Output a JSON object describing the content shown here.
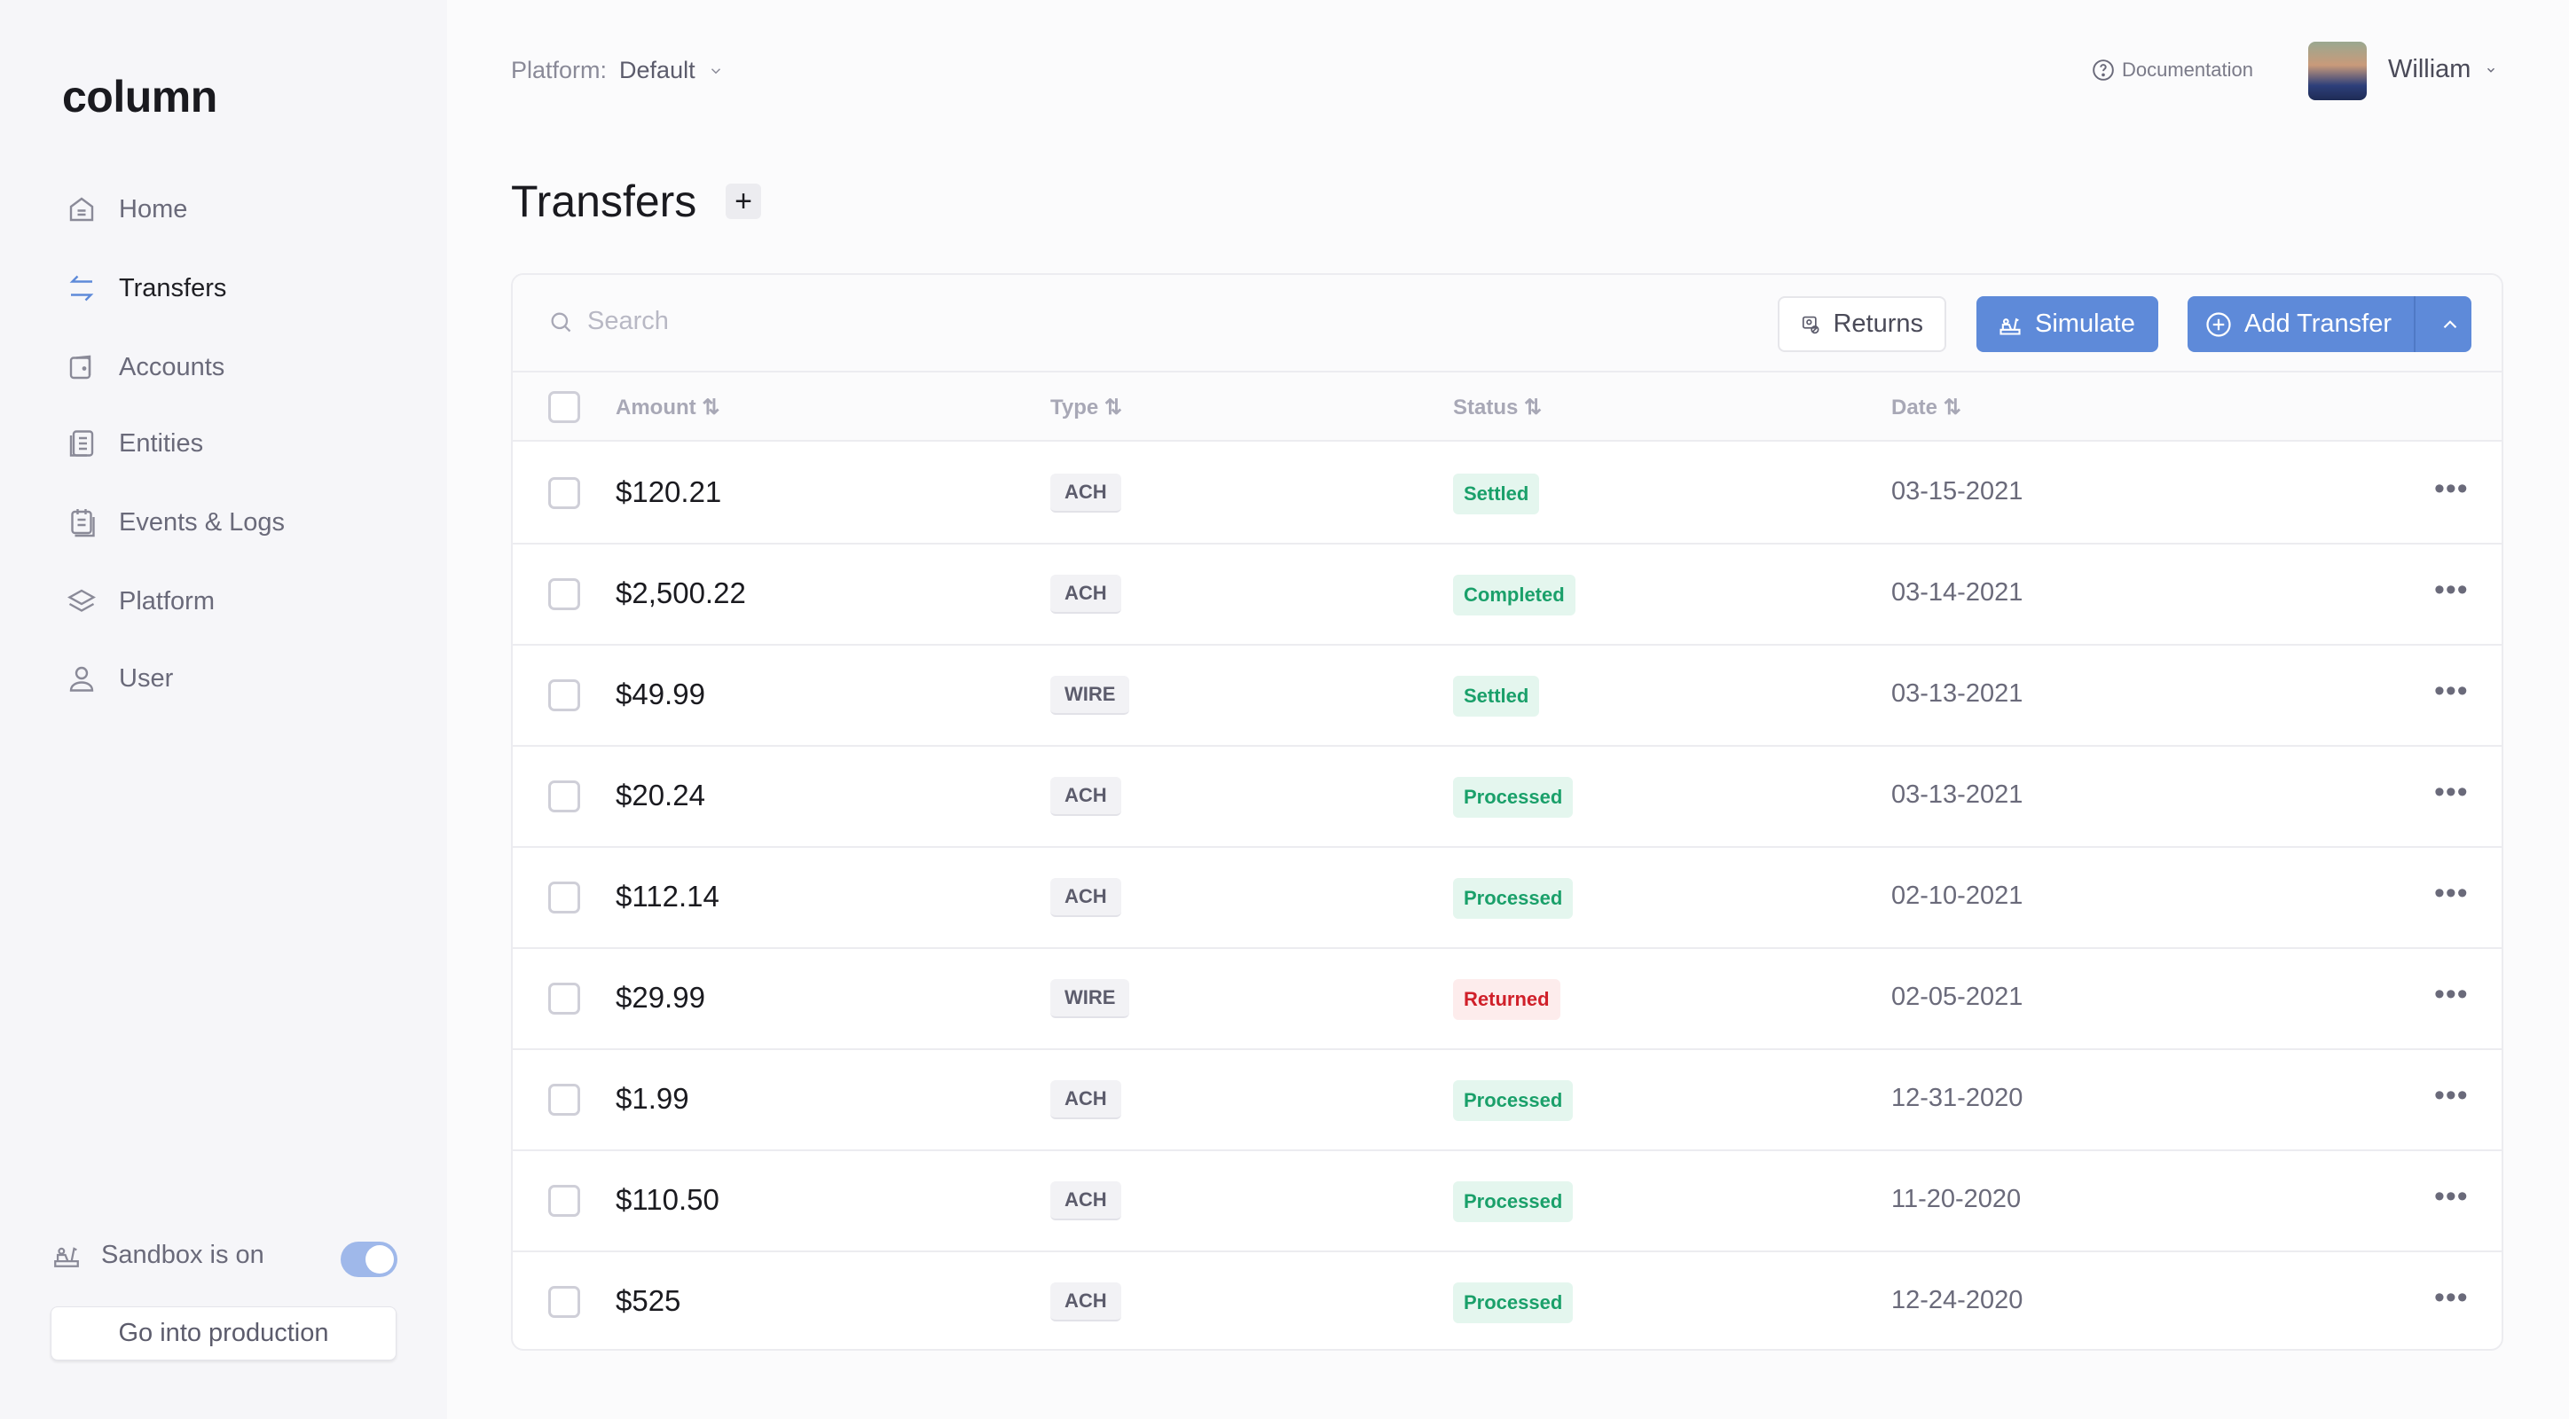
{
  "sidebar": {
    "logo": "column",
    "items": [
      {
        "label": "Home",
        "icon": "home-icon"
      },
      {
        "label": "Transfers",
        "icon": "transfers-icon",
        "active": true
      },
      {
        "label": "Accounts",
        "icon": "accounts-icon"
      },
      {
        "label": "Entities",
        "icon": "entities-icon"
      },
      {
        "label": "Events & Logs",
        "icon": "events-icon"
      },
      {
        "label": "Platform",
        "icon": "layers-icon"
      },
      {
        "label": "User",
        "icon": "user-icon"
      }
    ],
    "sandbox_label": "Sandbox is on",
    "sandbox_on": true,
    "production_button": "Go into production"
  },
  "header": {
    "platform_label": "Platform:",
    "platform_value": "Default",
    "documentation": "Documentation",
    "user_name": "William"
  },
  "page": {
    "title": "Transfers"
  },
  "toolbar": {
    "search_placeholder": "Search",
    "returns": "Returns",
    "simulate": "Simulate",
    "add_transfer": "Add Transfer"
  },
  "table": {
    "headers": [
      "Amount",
      "Type",
      "Status",
      "Date"
    ],
    "rows": [
      {
        "amount": "$120.21",
        "type": "ACH",
        "status": "Settled",
        "date": "03-15-2021"
      },
      {
        "amount": "$2,500.22",
        "type": "ACH",
        "status": "Completed",
        "date": "03-14-2021"
      },
      {
        "amount": "$49.99",
        "type": "WIRE",
        "status": "Settled",
        "date": "03-13-2021"
      },
      {
        "amount": "$20.24",
        "type": "ACH",
        "status": "Processed",
        "date": "03-13-2021"
      },
      {
        "amount": "$112.14",
        "type": "ACH",
        "status": "Processed",
        "date": "02-10-2021"
      },
      {
        "amount": "$29.99",
        "type": "WIRE",
        "status": "Returned",
        "date": "02-05-2021"
      },
      {
        "amount": "$1.99",
        "type": "ACH",
        "status": "Processed",
        "date": "12-31-2020"
      },
      {
        "amount": "$110.50",
        "type": "ACH",
        "status": "Processed",
        "date": "11-20-2020"
      },
      {
        "amount": "$525",
        "type": "ACH",
        "status": "Processed",
        "date": "12-24-2020"
      }
    ]
  },
  "colors": {
    "accent": "#5e8ad9",
    "success_bg": "#e4f6ee",
    "success_fg": "#1aa06a",
    "error_bg": "#fdecec",
    "error_fg": "#d0202a"
  }
}
